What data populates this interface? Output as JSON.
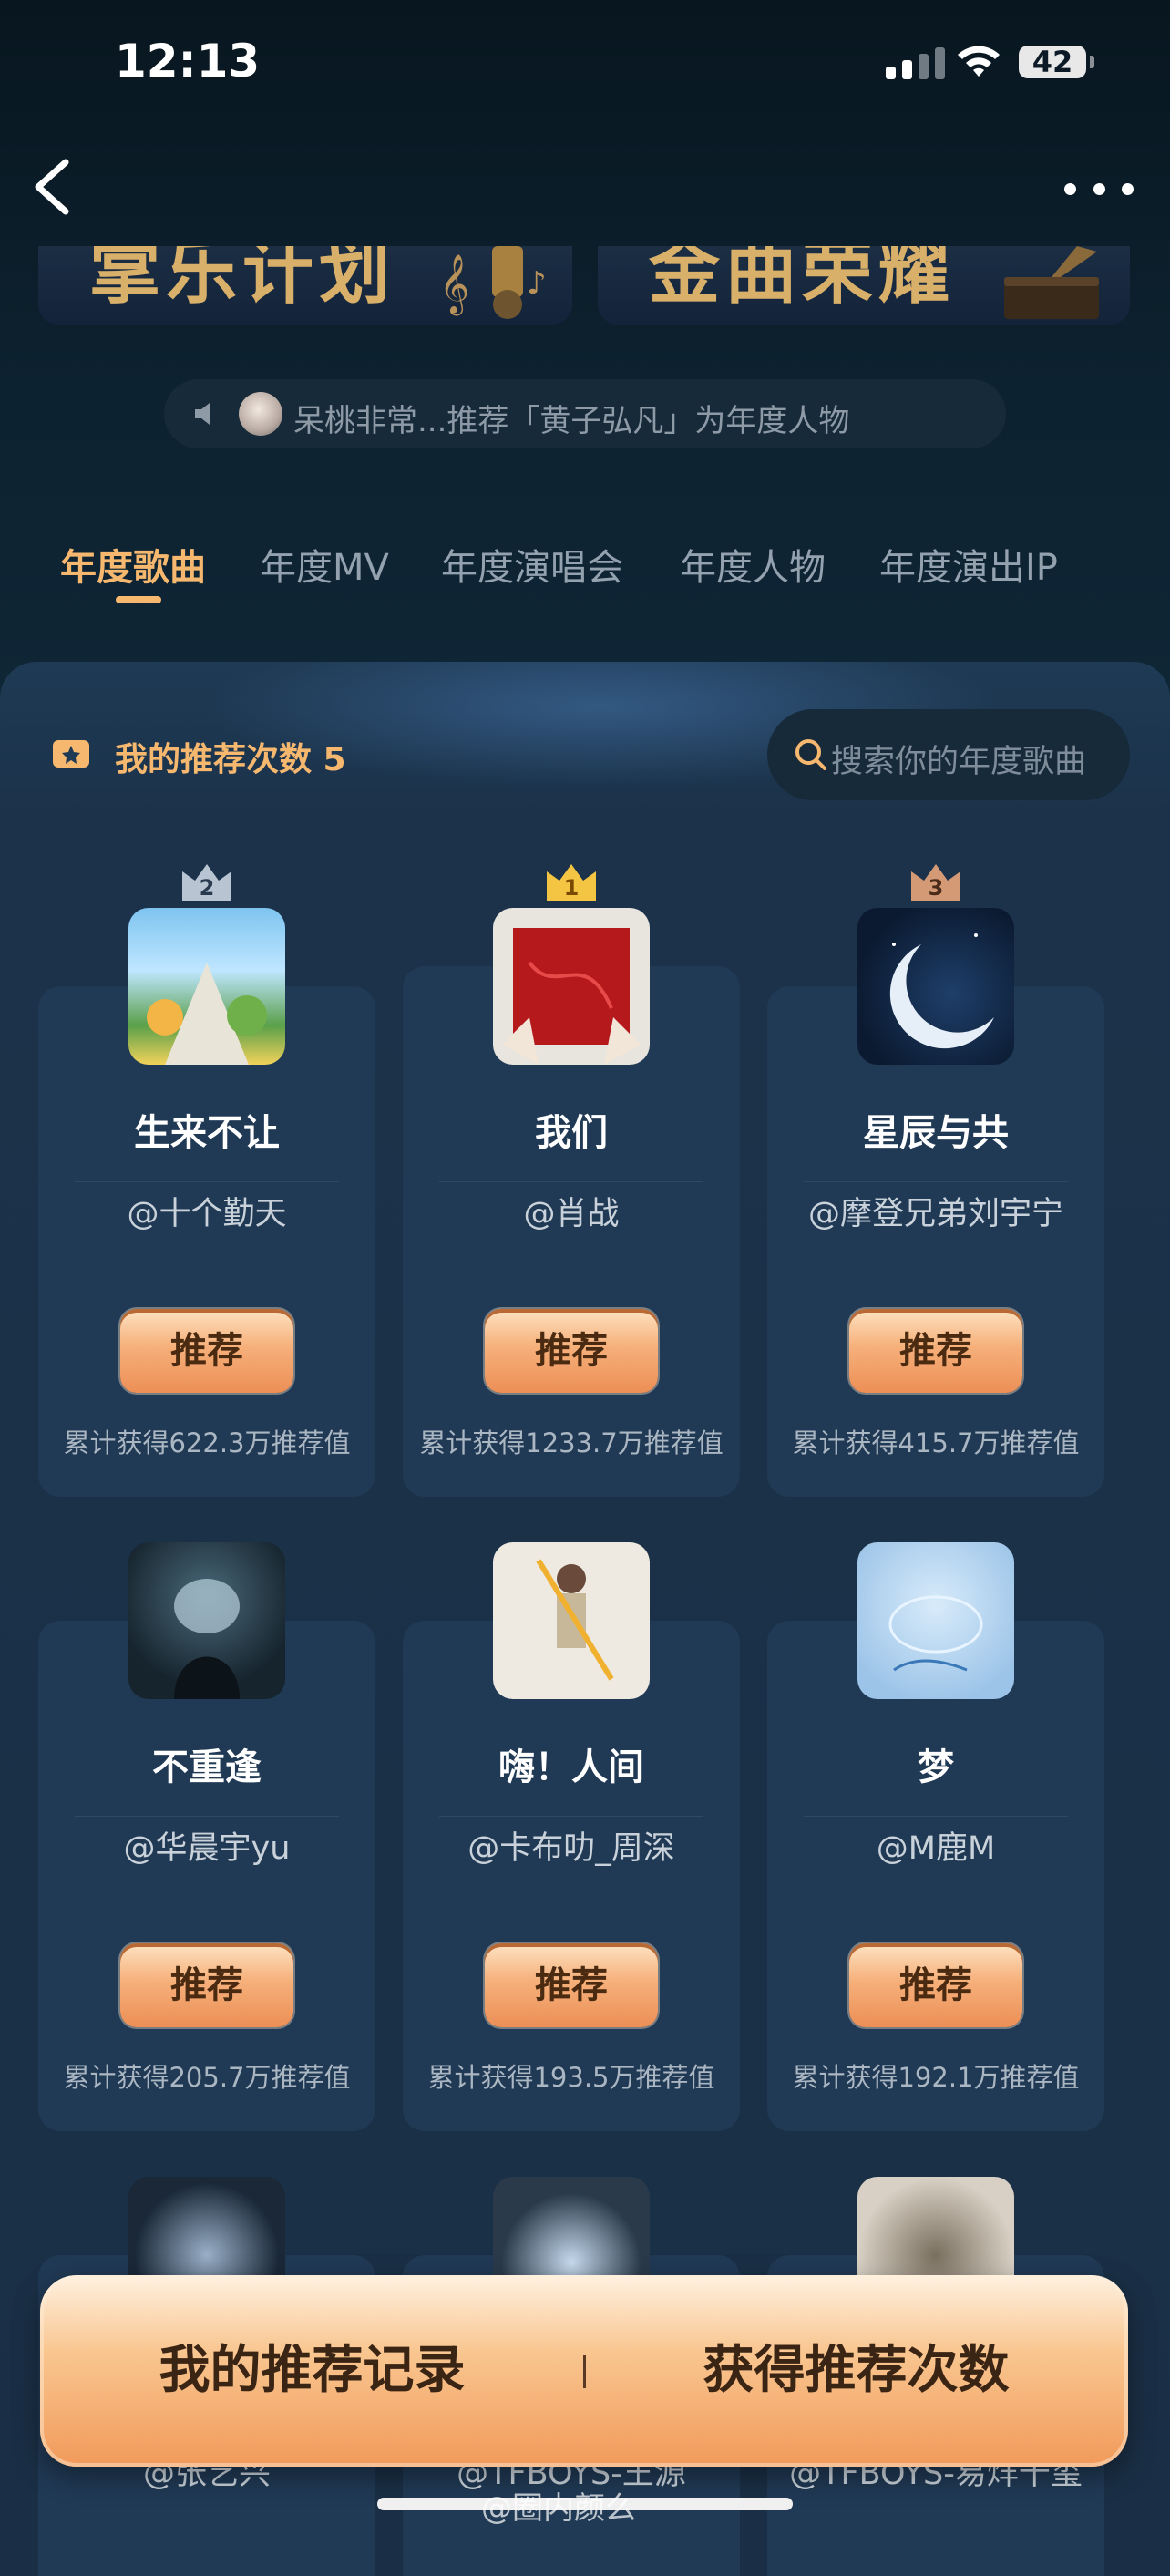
{
  "status_bar": {
    "time": "12:13",
    "battery": "42"
  },
  "banners": [
    {
      "text": "掌乐计划"
    },
    {
      "text": "金曲荣耀"
    }
  ],
  "ticker": {
    "text": "呆桃非常...推荐「黄子弘凡」为年度人物"
  },
  "tabs": [
    {
      "label": "年度歌曲",
      "active": true
    },
    {
      "label": "年度MV",
      "active": false
    },
    {
      "label": "年度演唱会",
      "active": false
    },
    {
      "label": "年度人物",
      "active": false
    },
    {
      "label": "年度演出IP",
      "active": false
    }
  ],
  "counter": {
    "label": "我的推荐次数 5"
  },
  "search": {
    "placeholder": "搜索你的年度歌曲"
  },
  "songs": [
    {
      "rank": "2",
      "title": "生来不让",
      "artist": "@十个勤天",
      "button": "推荐",
      "stat": "累计获得622.3万推荐值"
    },
    {
      "rank": "1",
      "title": "我们",
      "artist": "@肖战",
      "button": "推荐",
      "stat": "累计获得1233.7万推荐值"
    },
    {
      "rank": "3",
      "title": "星辰与共",
      "artist": "@摩登兄弟刘宇宁",
      "button": "推荐",
      "stat": "累计获得415.7万推荐值"
    },
    {
      "title": "不重逢",
      "artist": "@华晨宇yu",
      "button": "推荐",
      "stat": "累计获得205.7万推荐值"
    },
    {
      "title": "嗨！人间",
      "artist": "@卡布叻_周深",
      "button": "推荐",
      "stat": "累计获得193.5万推荐值"
    },
    {
      "title": "梦",
      "artist": "@M鹿M",
      "button": "推荐",
      "stat": "累计获得192.1万推荐值"
    },
    {
      "title": "",
      "artist": "@张艺兴"
    },
    {
      "title": "",
      "artist": "@TFBOYS-王源"
    },
    {
      "title": "",
      "artist": "@TFBOYS-易烊千玺"
    }
  ],
  "bottom_bar": {
    "records": "我的推荐记录",
    "get_more": "获得推荐次数"
  },
  "watermark": "@圈内颜么",
  "colors": {
    "accent": "#f6b76f",
    "background": "#0b1a26",
    "card": "#203954"
  }
}
